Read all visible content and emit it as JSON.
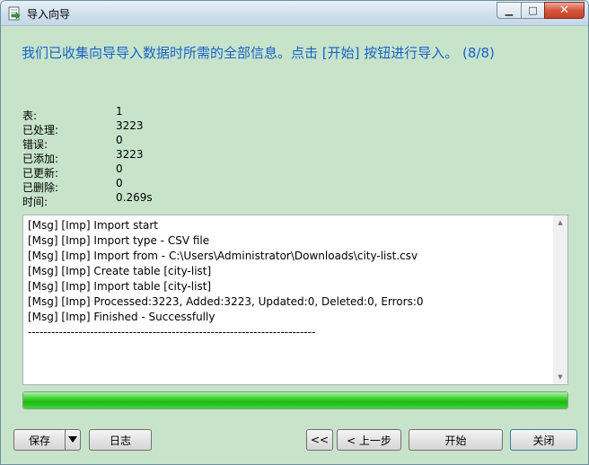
{
  "window": {
    "title": "导入向导",
    "minimize_symbol": "▁",
    "maximize_symbol": "□",
    "close_symbol": "✕"
  },
  "headline": "我们已收集向导导入数据时所需的全部信息。点击 [开始] 按钮进行导入。 (8/8)",
  "stats": [
    {
      "label": "表:",
      "value": "1"
    },
    {
      "label": "已处理:",
      "value": "3223"
    },
    {
      "label": "错误:",
      "value": "0"
    },
    {
      "label": "已添加:",
      "value": "3223"
    },
    {
      "label": "已更新:",
      "value": "0"
    },
    {
      "label": "已删除:",
      "value": "0"
    },
    {
      "label": "时间:",
      "value": "0.269s"
    }
  ],
  "log": {
    "lines": [
      "[Msg] [Imp] Import start",
      "[Msg] [Imp] Import type - CSV file",
      "[Msg] [Imp] Import from - C:\\Users\\Administrator\\Downloads\\city-list.csv",
      "[Msg] [Imp] Create table [city-list]",
      "[Msg] [Imp] Import table [city-list]",
      "[Msg] [Imp] Processed:3223, Added:3223, Updated:0, Deleted:0, Errors:0",
      "[Msg] [Imp] Finished - Successfully",
      "--------------------------------------------------------------------------"
    ],
    "scroll_up_symbol": "▲",
    "scroll_down_symbol": "▼"
  },
  "progress": {
    "value": 1.0,
    "fill_color": "#21b814"
  },
  "buttons": {
    "save": "保存",
    "log": "日志",
    "first": "<<",
    "back": "< 上一步",
    "start": "开始",
    "close": "关闭"
  },
  "icons": {
    "app": "import-wizard-icon",
    "save_dropdown": "chevron-down-icon"
  }
}
